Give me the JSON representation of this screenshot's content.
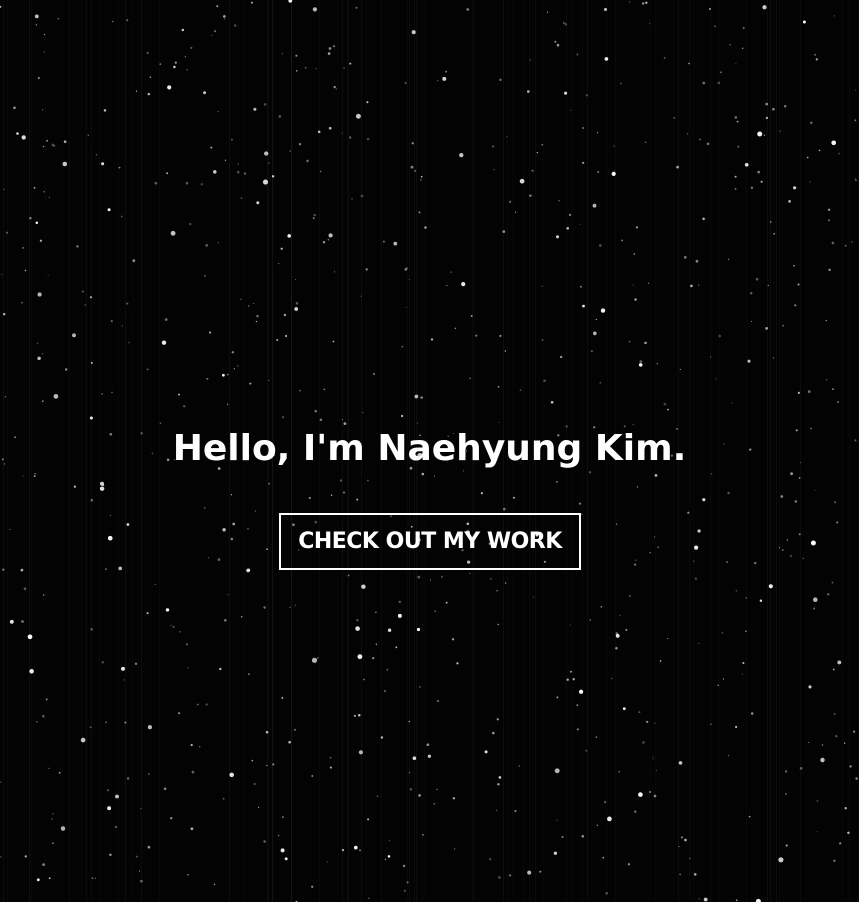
{
  "hero": {
    "title": "Hello, I'm Naehyung Kim.",
    "cta_label": "CHECK OUT MY WORK"
  },
  "colors": {
    "background": "#030303",
    "text": "#ffffff",
    "star": "#ffffff"
  }
}
